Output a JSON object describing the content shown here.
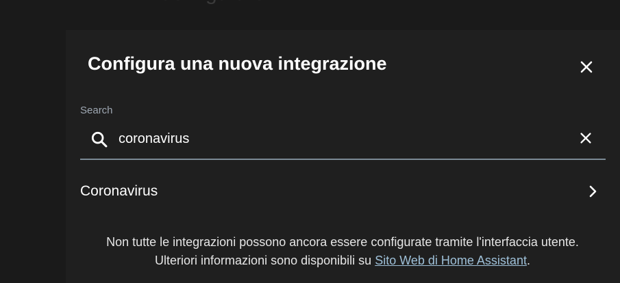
{
  "background": {
    "page_title": "Configurare"
  },
  "dialog": {
    "title": "Configura una nuova integrazione",
    "close_icon": "close-icon"
  },
  "search": {
    "label": "Search",
    "value": "coronavirus",
    "search_icon": "search-icon",
    "clear_icon": "close-icon"
  },
  "results": [
    {
      "label": "Coronavirus",
      "icon": "chevron-right-icon"
    }
  ],
  "footer": {
    "line1": "Non tutte le integrazioni possono ancora essere configurate tramite l'interfaccia utente.",
    "line2_prefix": "Ulteriori informazioni sono disponibili su ",
    "link_text": "Sito Web di Home Assistant",
    "line2_suffix": "."
  },
  "colors": {
    "background": "#1c1c1c",
    "dialog": "#1f1f1f",
    "text": "#ffffff",
    "label": "#9ea7b2",
    "link": "#9ec0d8",
    "underline": "#7b8a96"
  }
}
